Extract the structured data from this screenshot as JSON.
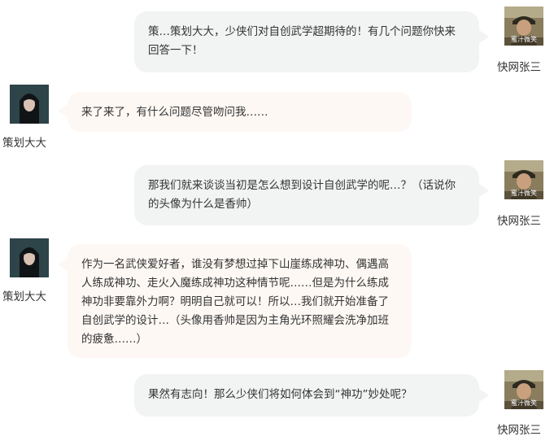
{
  "participants": {
    "host": {
      "name": "快网张三",
      "avatar_watermark": "蜜汁微笑"
    },
    "guest": {
      "name": "策划大大"
    }
  },
  "messages": [
    {
      "speaker": "host",
      "text": "策…策划大大，少侠们对自创武学超期待的！有几个问题你快来回答一下！"
    },
    {
      "speaker": "guest",
      "text": "来了来了，有什么问题尽管吻问我……"
    },
    {
      "speaker": "host",
      "text": "那我们就来谈谈当初是怎么想到设计自创武学的呢…？（话说你的头像为什么是香帅）"
    },
    {
      "speaker": "guest",
      "text": "作为一名武侠爱好者，谁没有梦想过掉下山崖练成神功、偶遇高人练成神功、走火入魔练成神功这种情节呢……但是为什么练成神功非要靠外力啊？明明自己就可以！所以…我们就开始准备了自创武学的设计…（头像用香帅是因为主角光环照耀会洗净加班的疲惫……）"
    },
    {
      "speaker": "host",
      "text": "果然有志向！那么少侠们将如何体会到“神功”妙处呢？"
    }
  ],
  "colors": {
    "host_bubble": "#f1f4f3",
    "guest_bubble": "#fdf8f4",
    "text": "#333333"
  },
  "icons": {
    "host_avatar": "host-avatar-photo",
    "guest_avatar": "guest-avatar-photo"
  }
}
